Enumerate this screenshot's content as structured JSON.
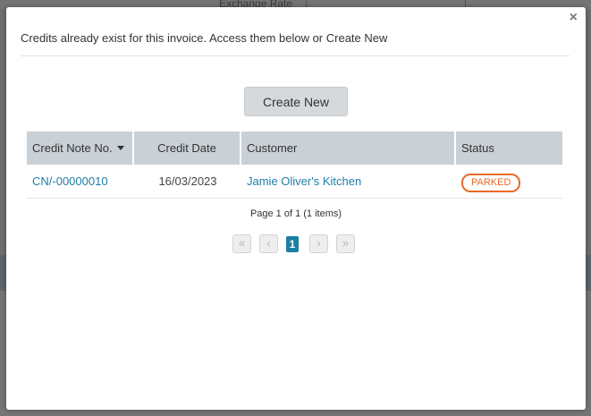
{
  "background": {
    "label": "Exchange Rate"
  },
  "modal": {
    "close_glyph": "×",
    "message": "Credits already exist for this invoice. Access them below or Create New",
    "create_new_label": "Create New"
  },
  "grid": {
    "columns": [
      "Credit Note No.",
      "Credit Date",
      "Customer",
      "Status"
    ],
    "rows": [
      {
        "credit_note_no": "CN/-00000010",
        "credit_date": "16/03/2023",
        "customer": "Jamie Oliver's Kitchen",
        "status": "PARKED"
      }
    ]
  },
  "pager": {
    "info": "Page 1 of 1 (1 items)",
    "first_glyph": "«",
    "prev_glyph": "‹",
    "current_page": "1",
    "next_glyph": "›",
    "last_glyph": "»"
  },
  "colors": {
    "link": "#1f7ea6",
    "status_parked": "#e86a2a",
    "header_bg": "#c9d0d6",
    "current_page_bg": "#1d7fa3"
  }
}
